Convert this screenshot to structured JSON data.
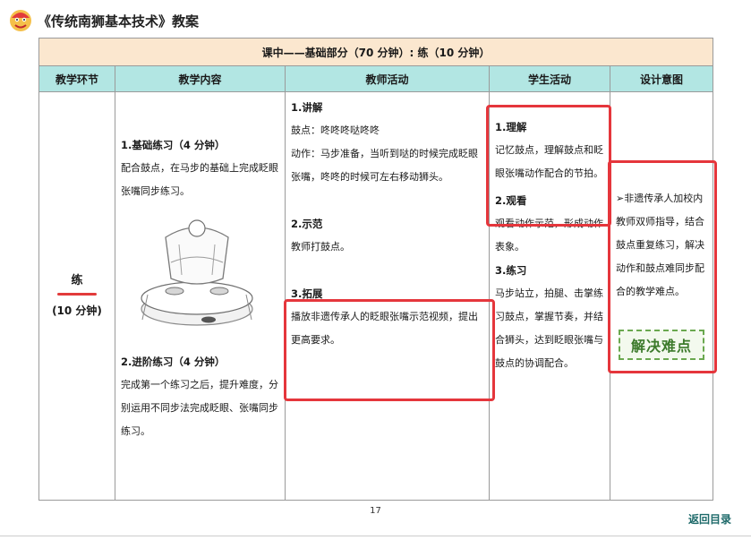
{
  "header": {
    "title": "《传统南狮基本技术》教案",
    "logo_icon": "lion-head-icon"
  },
  "table": {
    "section_title": "课中——基础部分（70 分钟）: 练（10 分钟）",
    "columns": [
      "教学环节",
      "教学内容",
      "教师活动",
      "学生活动",
      "设计意图"
    ],
    "segment": {
      "name": "练",
      "time": "(10 分钟)"
    },
    "content": {
      "item1_title": "1.基础练习（4 分钟）",
      "item1_text": "配合鼓点，在马步的基础上完成眨眼张嘴同步练习。",
      "item2_title": "2.进阶练习（4 分钟）",
      "item2_text": "完成第一个练习之后，提升难度，分别运用不同步法完成眨眼、张嘴同步练习。"
    },
    "teacher": {
      "s1_title": "1.讲解",
      "s1_line1": "鼓点：咚咚咚哒咚咚",
      "s1_line2": "动作：马步准备，当听到哒的时候完成眨眼张嘴，咚咚的时候可左右移动狮头。",
      "s2_title": "2.示范",
      "s2_text": "教师打鼓点。",
      "s3_title": "3.拓展",
      "s3_text": "播放非遗传承人的眨眼张嘴示范视频，提出更高要求。"
    },
    "student": {
      "s1_title": "1.理解",
      "s1_text": "记忆鼓点，理解鼓点和眨眼张嘴动作配合的节拍。",
      "s2_title": "2.观看",
      "s2_text": "观看动作示范，形成动作表象。",
      "s3_title": "3.练习",
      "s3_text": "马步站立，拍腿、击掌练习鼓点，掌握节奏，并结合狮头，达到眨眼张嘴与鼓点的协调配合。"
    },
    "design": {
      "text": "➢非遗传承人加校内教师双师指导，结合鼓点重复练习，解决动作和鼓点难同步配合的教学难点。",
      "stamp": "解决难点"
    }
  },
  "footer": {
    "page_number": "17",
    "return_link": "返回目录"
  },
  "colors": {
    "title_row_bg": "#fbe7cf",
    "header_row_bg": "#b2e6e3",
    "highlight_box": "#e5363c",
    "stamp_green": "#3c7a2b"
  }
}
